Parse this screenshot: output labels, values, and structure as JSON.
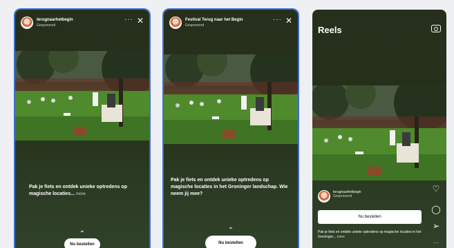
{
  "screens": [
    {
      "account": "terugnaarhetbegin",
      "sub": "Gesponsord",
      "caption": "Pak je fiets en ontdek unieke optredens op magische locaties...",
      "more": "more",
      "cta": "Nu bestellen"
    },
    {
      "account": "Festival Terug naar het Begin",
      "sub": "Gesponsord",
      "caption": "Pak je fiets en ontdek unieke optredens op magische locaties in het Groninger landschap. Wie neem jij mee?",
      "cta": "Nu bestellen"
    },
    {
      "title": "Reels",
      "account": "terugnaarhetbegin",
      "sub": "Gesponsord",
      "cta": "Nu bestellen",
      "caption": "Pak je fiets en ontdek unieke optredens op magische locaties in het Groninger...",
      "more": "more"
    }
  ],
  "icons": {
    "menu": "dots-icon",
    "close": "close-icon",
    "camera": "camera-icon",
    "like": "heart-icon",
    "comment": "comment-icon",
    "share": "send-icon",
    "expand": "chevron-up-icon"
  },
  "colors": {
    "highlight_border": "#3d6fd1",
    "background": "#eef0f3"
  }
}
